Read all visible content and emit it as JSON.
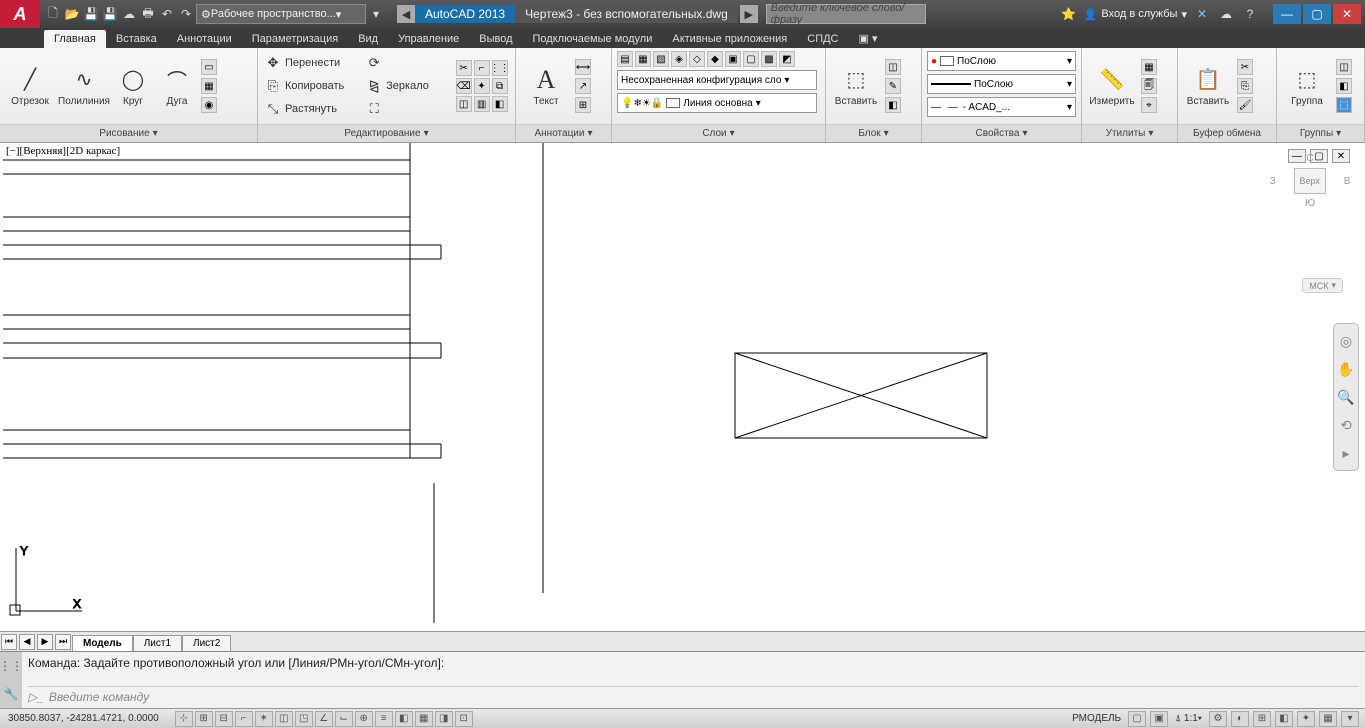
{
  "title": {
    "app": "AutoCAD 2013",
    "doc": "Чертеж3 - без вспомогательных.dwg"
  },
  "qat": {
    "workspace": "Рабочее пространство..."
  },
  "search": {
    "placeholder": "Введите ключевое слово/фразу"
  },
  "signin": {
    "label": "Вход в службы"
  },
  "tabs": [
    "Главная",
    "Вставка",
    "Аннотации",
    "Параметризация",
    "Вид",
    "Управление",
    "Вывод",
    "Подключаемые модули",
    "Активные приложения",
    "СПДС"
  ],
  "ribbon": {
    "draw": {
      "title": "Рисование",
      "line": "Отрезок",
      "pline": "Полилиния",
      "circle": "Круг",
      "arc": "Дуга"
    },
    "modify": {
      "title": "Редактирование",
      "move": "Перенести",
      "copy": "Копировать",
      "stretch": "Растянуть",
      "rotate": "Повернуть",
      "mirror": "Зеркало",
      "scale": "Масштаб"
    },
    "annot": {
      "title": "Аннотации",
      "text": "Текст"
    },
    "layers": {
      "title": "Слои",
      "unsaved": "Несохраненная конфигурация сло",
      "current": "Линия основна"
    },
    "block": {
      "title": "Блок",
      "insert": "Вставить"
    },
    "props": {
      "title": "Свойства",
      "color": "ПоСлою",
      "lw": "ПоСлою",
      "lt": "- ACAD_..."
    },
    "util": {
      "title": "Утилиты",
      "measure": "Измерить"
    },
    "clip": {
      "title": "Буфер обмена",
      "paste": "Вставить"
    },
    "group": {
      "title": "Группы",
      "group": "Группа"
    }
  },
  "viewport": {
    "label": "[−][Верхняя][2D каркас]"
  },
  "viewcube": {
    "top": "С",
    "left": "З",
    "right": "В",
    "bottom": "Ю",
    "face": "Верх",
    "wcs": "МСК"
  },
  "layout": {
    "model": "Модель",
    "l1": "Лист1",
    "l2": "Лист2"
  },
  "cmd": {
    "hist": "Команда: Задайте противоположный угол или [Линия/РМн-угол/СМн-угол]:",
    "prompt": "Введите команду"
  },
  "status": {
    "coords": "30850.8037, -24281.4721, 0.0000",
    "space": "РМОДЕЛЬ",
    "scale": "1:1"
  }
}
